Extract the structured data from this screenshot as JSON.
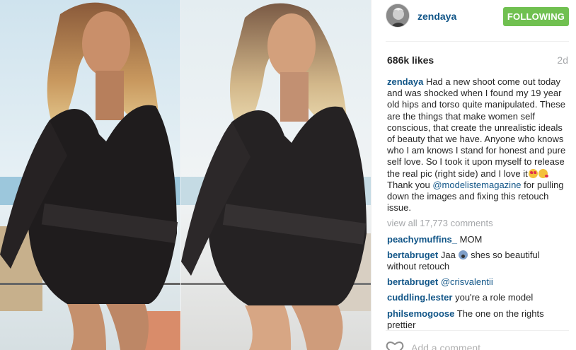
{
  "post": {
    "username": "zendaya",
    "follow_label": "FOLLOWING",
    "likes": "686k likes",
    "time_ago": "2d",
    "caption_user": "zendaya",
    "caption_part1": "Had a new shoot come out today and was shocked when I found my 19 year old hips and torso quite manipulated. These are the things that make women self conscious, that create the unrealistic ideals of beauty that we have. Anyone who knows who I am knows I stand for honest and pure self love. So I took it upon myself to release the real pic (right side) and I love it",
    "caption_part2": "Thank you",
    "caption_mention": "@modelistemagazine",
    "caption_part3": "for pulling down the images and fixing this retouch issue.",
    "view_all": "view all 17,773 comments",
    "add_comment_placeholder": "Add a comment..."
  },
  "comments": [
    {
      "user": "peachymuffins_",
      "text": "MOM"
    },
    {
      "user": "bertabruget",
      "text_before": "Jaa",
      "text_after": "shes so beautiful without retouch"
    },
    {
      "user": "bertabruget",
      "mention": "@crisvalentii"
    },
    {
      "user": "cuddling.lester",
      "text": "you're a role model"
    },
    {
      "user": "philsemogoose",
      "text": "The one on the rights prettier"
    }
  ],
  "icons": {
    "avatar": "avatar-image",
    "like": "heart-outline-icon"
  },
  "colors": {
    "link": "#125688",
    "follow_button": "#70c050",
    "muted": "#a5a7aa"
  }
}
